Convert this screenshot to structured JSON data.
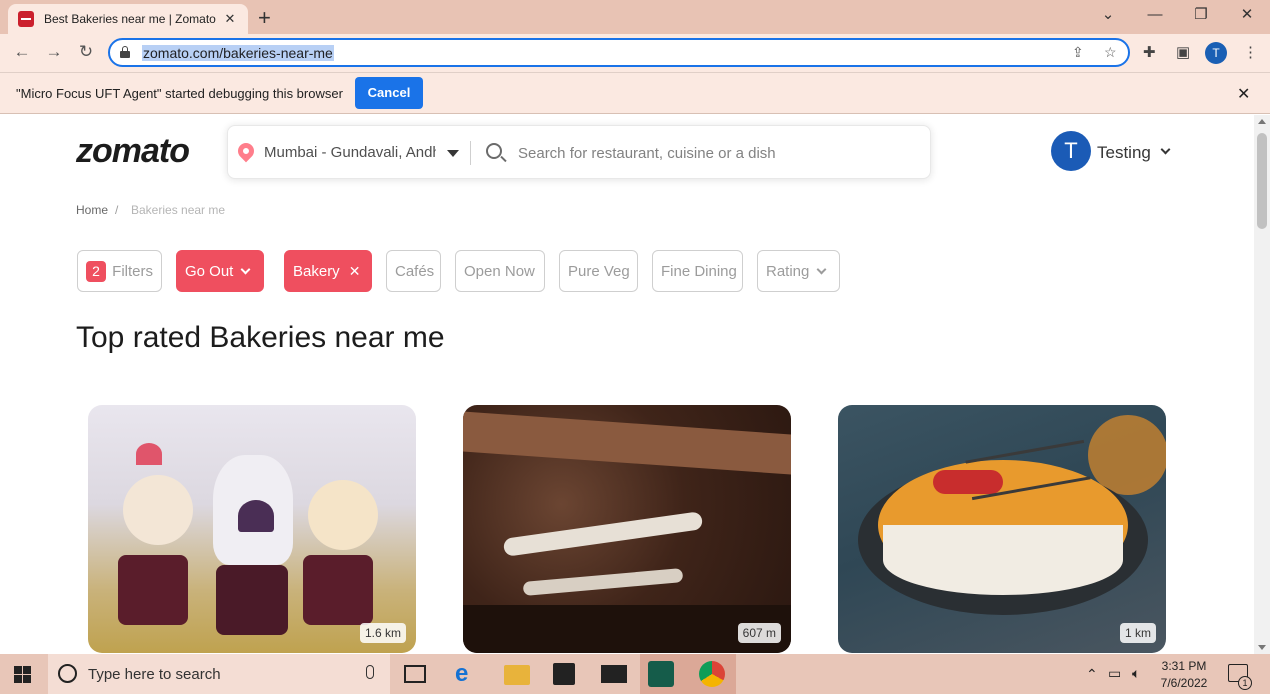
{
  "browser": {
    "tab_title": "Best Bakeries near me | Zomato",
    "tab_close": "✕",
    "new_tab": "+",
    "url": "zomato.com/bakeries-near-me",
    "profile_initial": "T",
    "window_controls": {
      "dropdown": "⌄",
      "minimize": "—",
      "restore": "❐",
      "close": "✕"
    }
  },
  "infobar": {
    "message": "\"Micro Focus UFT Agent\" started debugging this browser",
    "cancel_label": "Cancel",
    "close": "✕"
  },
  "site": {
    "logo": "zomato",
    "location": "Mumbai - Gundavali, Andh",
    "search_placeholder": "Search for restaurant, cuisine or a dish",
    "user_initial": "T",
    "user_name": "Testing"
  },
  "breadcrumb": {
    "home": "Home",
    "separator": "/",
    "current": "Bakeries near me"
  },
  "filters": {
    "count": "2",
    "filters_label": "Filters",
    "go_out": "Go Out",
    "bakery": "Bakery",
    "cafes": "Cafés",
    "open_now": "Open Now",
    "pure_veg": "Pure Veg",
    "fine_dining": "Fine Dining",
    "rating": "Rating"
  },
  "section_title": "Top rated Bakeries near me",
  "cards": [
    {
      "distance": "1.6 km",
      "image": "cupcakes-photo"
    },
    {
      "distance": "607 m",
      "image": "chocolate-cake-photo"
    },
    {
      "distance": "1 km",
      "image": "caramel-cake-photo"
    }
  ],
  "taskbar": {
    "search_placeholder": "Type here to search",
    "time": "3:31 PM",
    "date": "7/6/2022",
    "notification_count": "1"
  },
  "colors": {
    "brand_red": "#ef4f5f",
    "chrome_tint": "#e8c3b4",
    "link_blue": "#1a73e8"
  }
}
